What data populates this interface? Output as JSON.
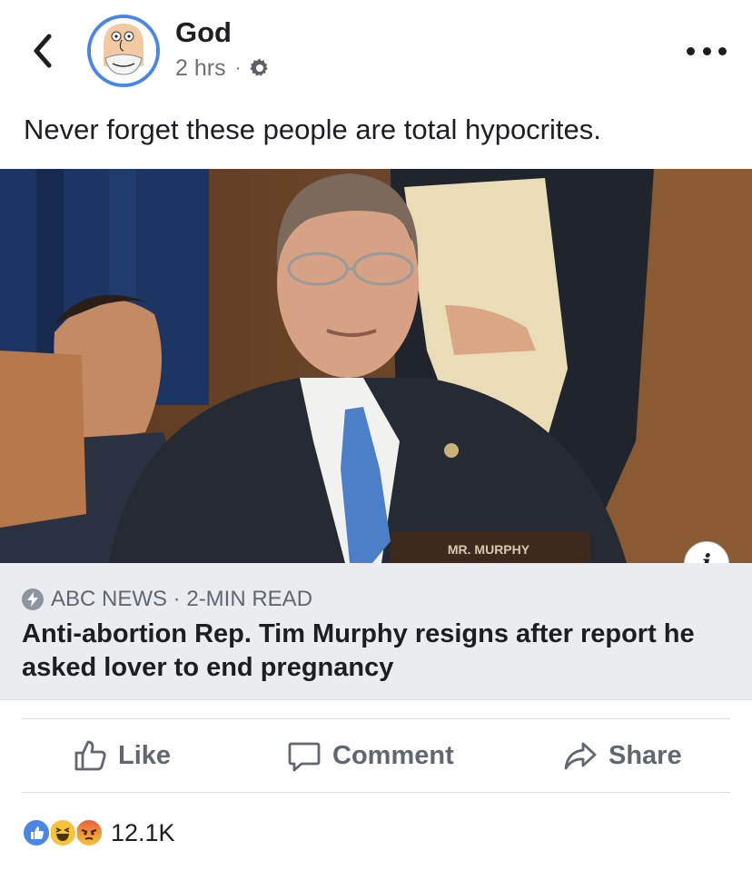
{
  "post": {
    "author": "God",
    "time": "2 hrs",
    "separator": "·",
    "text": "Never forget these people are total hypocrites."
  },
  "link_preview": {
    "source": "ABC NEWS · 2-MIN READ",
    "headline": "Anti-abortion Rep. Tim Murphy resigns after report he asked lover to end pregnancy",
    "image_nameplate": "MR. MURPHY",
    "info_label": "i"
  },
  "actions": {
    "like": "Like",
    "comment": "Comment",
    "share": "Share"
  },
  "reactions": {
    "types": [
      "like-icon",
      "haha-icon",
      "angry-icon"
    ],
    "count": "12.1K"
  },
  "colors": {
    "like_blue": "#4a86e8",
    "muted_gray": "#606770",
    "link_bg": "#eaecef"
  }
}
